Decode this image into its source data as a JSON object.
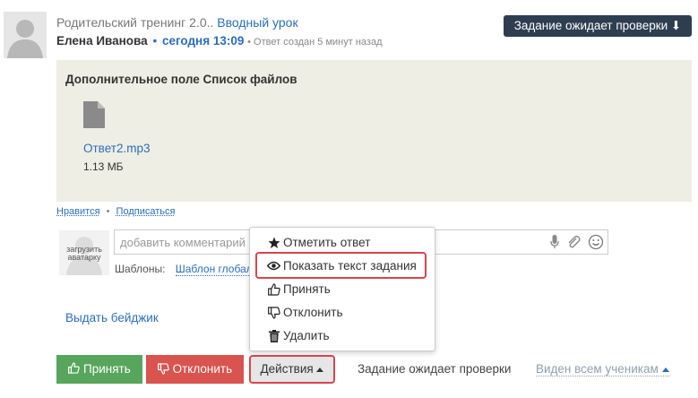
{
  "post": {
    "course": "Родительский тренинг 2.0..",
    "lesson": "Вводный урок",
    "author": "Елена Иванова",
    "separator": "•",
    "time": "сегодня 13:09",
    "created": "• Ответ создан 5 минут назад",
    "status_badge": "Задание ожидает проверки ⬇"
  },
  "attachment": {
    "title": "Дополнительное поле Список файлов",
    "file_name": "Ответ2.mp3",
    "file_size": "1.13 МБ",
    "icon": "file-icon"
  },
  "social": {
    "like": "Нравится",
    "dot": "•",
    "subscribe": "Подписаться"
  },
  "comment": {
    "avatar_label": "загрузить аватарку",
    "placeholder": "добавить комментарий",
    "templates_label": "Шаблоны:",
    "template_link": "Шаблон глобаль"
  },
  "badge_link": "Выдать бейджик",
  "menu": {
    "items": [
      {
        "icon": "star-icon",
        "label": "Отметить ответ"
      },
      {
        "icon": "eye-icon",
        "label": "Показать текст задания"
      },
      {
        "icon": "thumbs-up-icon",
        "label": "Принять"
      },
      {
        "icon": "thumbs-down-icon",
        "label": "Отклонить"
      },
      {
        "icon": "trash-icon",
        "label": "Удалить"
      }
    ]
  },
  "buttons": {
    "accept": "Принять",
    "reject": "Отклонить",
    "actions": "Действия"
  },
  "footer": {
    "status": "Задание ожидает проверки",
    "visibility": "Виден всем ученикам"
  },
  "colors": {
    "accent": "#2a6ebb",
    "accept": "#58a55c",
    "reject": "#d9534f",
    "badge": "#2d3e50",
    "highlight": "#d64550"
  }
}
